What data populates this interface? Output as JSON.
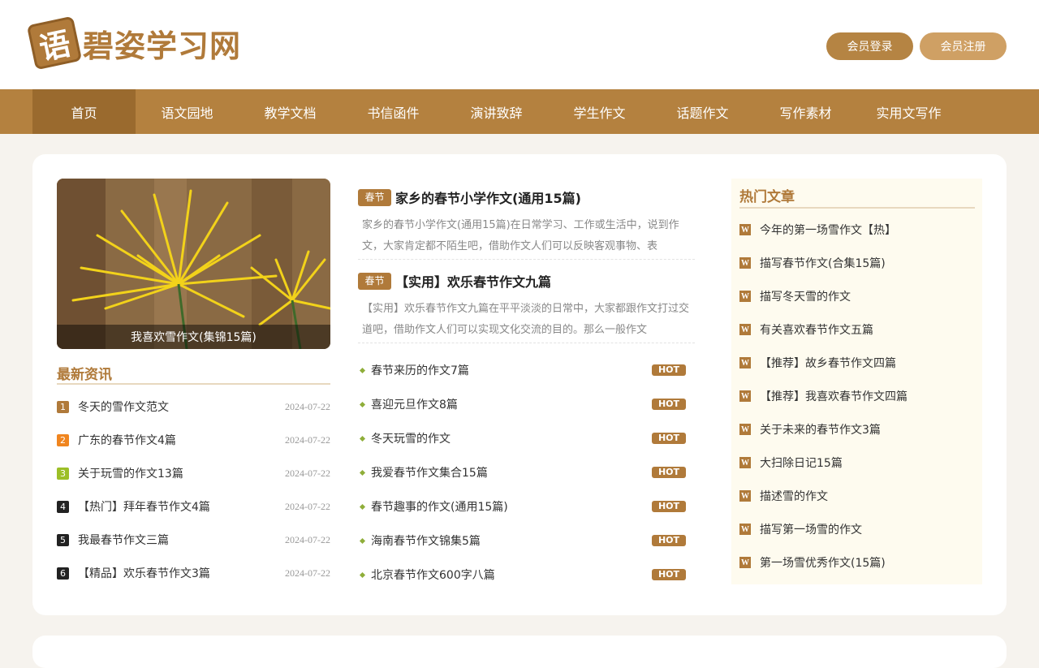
{
  "site": {
    "logo_char": "语",
    "logo_text": "碧姿学习网"
  },
  "header": {
    "login_label": "会员登录",
    "register_label": "会员注册"
  },
  "nav": {
    "items": [
      {
        "label": "首页"
      },
      {
        "label": "语文园地"
      },
      {
        "label": "教学文档"
      },
      {
        "label": "书信函件"
      },
      {
        "label": "演讲致辞"
      },
      {
        "label": "学生作文"
      },
      {
        "label": "话题作文"
      },
      {
        "label": "写作素材"
      },
      {
        "label": "实用文写作"
      }
    ]
  },
  "feature": {
    "caption": "我喜欢雪作文(集锦15篇)"
  },
  "latest": {
    "title": "最新资讯",
    "items": [
      {
        "num": "1",
        "title": "冬天的雪作文范文",
        "date": "2024-07-22",
        "color": "#b07a3a"
      },
      {
        "num": "2",
        "title": "广东的春节作文4篇",
        "date": "2024-07-22",
        "color": "#f0851f"
      },
      {
        "num": "3",
        "title": "关于玩雪的作文13篇",
        "date": "2024-07-22",
        "color": "#9cbf27"
      },
      {
        "num": "4",
        "title": "【热门】拜年春节作文4篇",
        "date": "2024-07-22",
        "color": "#222222"
      },
      {
        "num": "5",
        "title": "我最春节作文三篇",
        "date": "2024-07-22",
        "color": "#222222"
      },
      {
        "num": "6",
        "title": "【精品】欢乐春节作文3篇",
        "date": "2024-07-22",
        "color": "#222222"
      }
    ]
  },
  "articles": [
    {
      "tag": "春节",
      "title": "家乡的春节小学作文(通用15篇)",
      "desc": "家乡的春节小学作文(通用15篇)在日常学习、工作或生活中，说到作文，大家肯定都不陌生吧，借助作文人们可以反映客观事物、表"
    },
    {
      "tag": "春节",
      "title": "【实用】欢乐春节作文九篇",
      "desc": "【实用】欢乐春节作文九篇在平平淡淡的日常中，大家都跟作文打过交道吧，借助作文人们可以实现文化交流的目的。那么一般作文"
    }
  ],
  "hot_list": {
    "badge": "HOT",
    "items": [
      {
        "title": "春节来历的作文7篇"
      },
      {
        "title": "喜迎元旦作文8篇"
      },
      {
        "title": "冬天玩雪的作文"
      },
      {
        "title": "我爱春节作文集合15篇"
      },
      {
        "title": "春节趣事的作文(通用15篇)"
      },
      {
        "title": "海南春节作文锦集5篇"
      },
      {
        "title": "北京春节作文600字八篇"
      }
    ]
  },
  "popular": {
    "title": "热门文章",
    "icon_char": "W",
    "items": [
      {
        "title": "今年的第一场雪作文【热】"
      },
      {
        "title": "描写春节作文(合集15篇)"
      },
      {
        "title": "描写冬天雪的作文"
      },
      {
        "title": "有关喜欢春节作文五篇"
      },
      {
        "title": "【推荐】故乡春节作文四篇"
      },
      {
        "title": "【推荐】我喜欢春节作文四篇"
      },
      {
        "title": "关于未来的春节作文3篇"
      },
      {
        "title": "大扫除日记15篇"
      },
      {
        "title": "描述雪的作文"
      },
      {
        "title": "描写第一场雪的作文"
      },
      {
        "title": "第一场雪优秀作文(15篇)"
      }
    ]
  }
}
